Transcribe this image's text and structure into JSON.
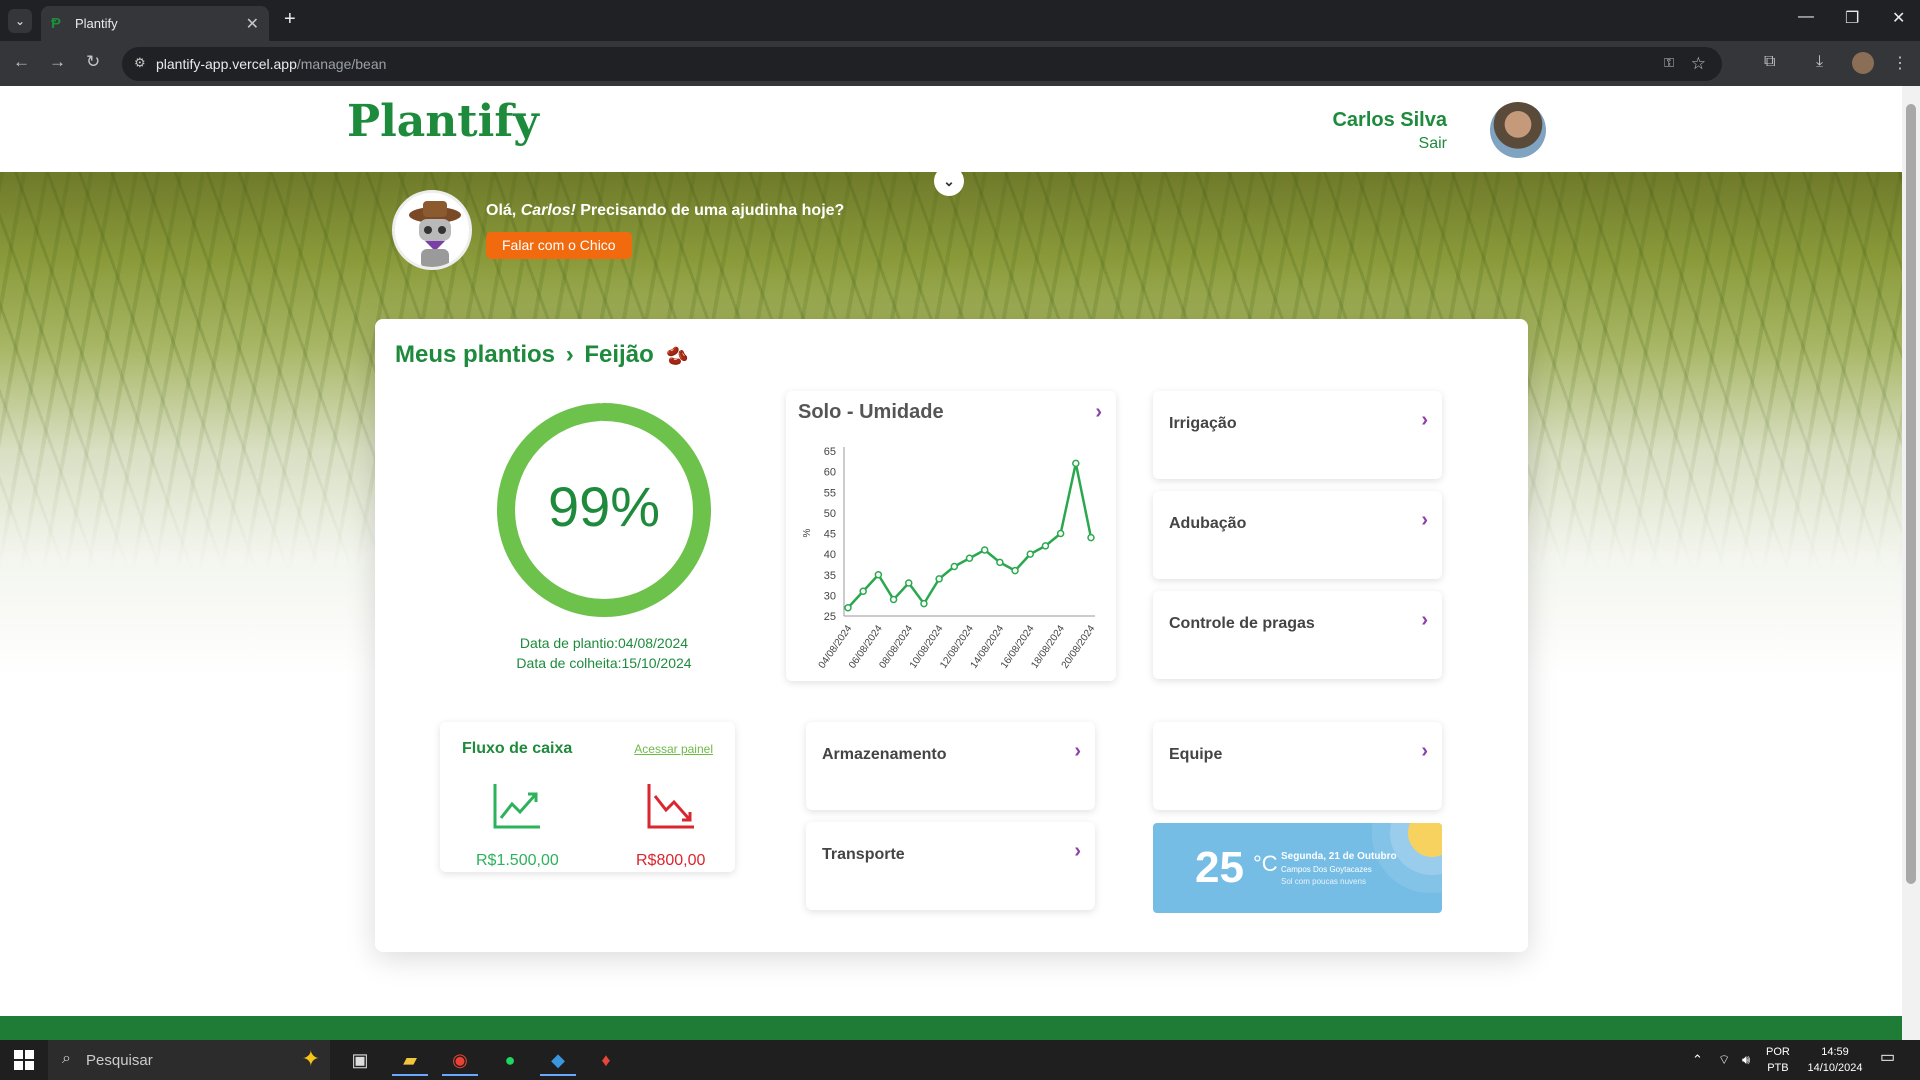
{
  "browser": {
    "tab_title": "Plantify",
    "tab_close": "✕",
    "new_tab": "+",
    "url_host": "plantify-app.vercel.app",
    "url_path": "/manage/bean"
  },
  "header": {
    "logo": "Plantify",
    "user_name": "Carlos Silva",
    "logout": "Sair"
  },
  "assistant": {
    "greeting_prefix": "Olá, ",
    "greeting_name": "Carlos!",
    "greeting_suffix": " Precisando de uma ajudinha hoje?",
    "button": "Falar com o Chico"
  },
  "breadcrumb": {
    "parent": "Meus plantios",
    "separator": "›",
    "current": "Feijão"
  },
  "progress": {
    "percent_label": "99%",
    "percent_value": 99,
    "planting_date": "Data de plantio:04/08/2024",
    "harvest_date": "Data de colheita:15/10/2024"
  },
  "soil": {
    "title": "Solo - Umidade"
  },
  "chart_data": {
    "type": "line",
    "title": "Solo - Umidade",
    "xlabel": "",
    "ylabel": "%",
    "ylim": [
      25,
      65
    ],
    "yticks": [
      25,
      30,
      35,
      40,
      45,
      50,
      55,
      60,
      65
    ],
    "xtick_labels": [
      "04/08/2024",
      "06/08/2024",
      "08/08/2024",
      "10/08/2024",
      "12/08/2024",
      "14/08/2024",
      "16/08/2024",
      "18/08/2024",
      "20/08/2024"
    ],
    "color": "#2aa84f",
    "x": [
      "04/08/2024",
      "05/08/2024",
      "06/08/2024",
      "07/08/2024",
      "08/08/2024",
      "09/08/2024",
      "10/08/2024",
      "11/08/2024",
      "12/08/2024",
      "13/08/2024",
      "14/08/2024",
      "15/08/2024",
      "16/08/2024",
      "17/08/2024",
      "18/08/2024",
      "19/08/2024",
      "20/08/2024"
    ],
    "values": [
      27,
      31,
      35,
      29,
      33,
      28,
      34,
      37,
      39,
      41,
      38,
      36,
      40,
      42,
      45,
      62,
      44
    ]
  },
  "modules": {
    "irrigacao": "Irrigação",
    "adubacao": "Adubação",
    "pragas": "Controle de pragas",
    "armazenamento": "Armazenamento",
    "transporte": "Transporte",
    "equipe": "Equipe"
  },
  "cashflow": {
    "title": "Fluxo de caixa",
    "link": "Acessar painel",
    "income": "R$1.500,00",
    "expense": "R$800,00"
  },
  "weather": {
    "temp": "25",
    "unit": "°C",
    "day": "Segunda, 21 de Outubro",
    "city": "Campos Dos Goytacazes",
    "condition": "Sol com poucas nuvens"
  },
  "taskbar": {
    "search_placeholder": "Pesquisar",
    "lang_top": "POR",
    "lang_bottom": "PTB",
    "time": "14:59",
    "date": "14/10/2024"
  },
  "colors": {
    "brand_green": "#1e8a3c",
    "accent_orange": "#f26a0e",
    "arrow_purple": "#8b3fa8",
    "ring_green": "#6cc24a",
    "expense_red": "#d9262f"
  }
}
